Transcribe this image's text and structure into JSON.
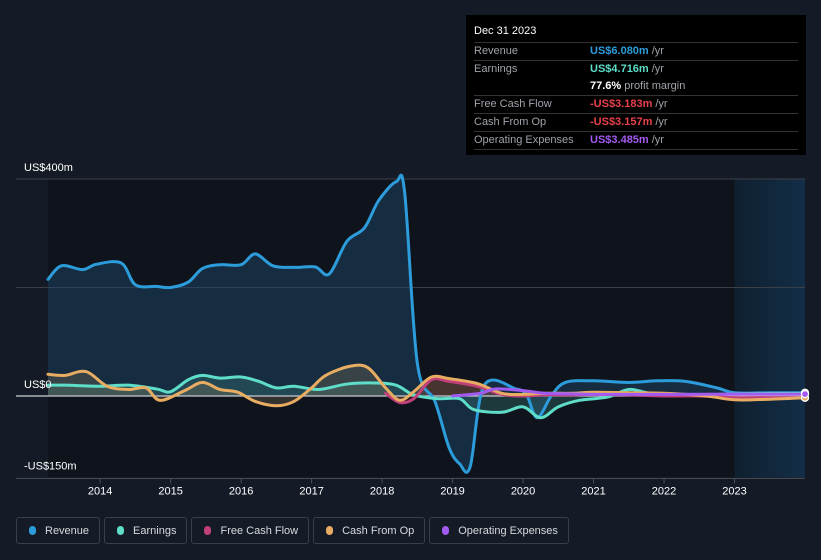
{
  "tooltip": {
    "date": "Dec 31 2023",
    "rows": [
      {
        "label": "Revenue",
        "value": "US$6.080m",
        "unit": "/yr",
        "color": "#2d9cdb"
      },
      {
        "label": "Earnings",
        "value": "US$4.716m",
        "unit": "/yr",
        "color": "#5eddc8"
      },
      {
        "label": "",
        "value": "77.6%",
        "unit": "profit margin",
        "color": "#ffffff"
      },
      {
        "label": "Free Cash Flow",
        "value": "-US$3.183m",
        "unit": "/yr",
        "color": "#e8414b"
      },
      {
        "label": "Cash From Op",
        "value": "-US$3.157m",
        "unit": "/yr",
        "color": "#e8414b"
      },
      {
        "label": "Operating Expenses",
        "value": "US$3.485m",
        "unit": "/yr",
        "color": "#a35af0"
      }
    ]
  },
  "legend": [
    {
      "label": "Revenue",
      "color": "#2d9cdb"
    },
    {
      "label": "Earnings",
      "color": "#5eddc8"
    },
    {
      "label": "Free Cash Flow",
      "color": "#c2407a"
    },
    {
      "label": "Cash From Op",
      "color": "#e8ad62"
    },
    {
      "label": "Operating Expenses",
      "color": "#a35af0"
    }
  ],
  "chart_data": {
    "type": "line",
    "title": "",
    "xlabel": "",
    "ylabel": "",
    "ylim": [
      -150,
      400
    ],
    "xlim": [
      2013.26,
      2024.0
    ],
    "y_tick_labels": [
      {
        "value": 400,
        "label": "US$400m"
      },
      {
        "value": 0,
        "label": "US$0"
      },
      {
        "value": -150,
        "label": "-US$150m"
      }
    ],
    "gridlines": [
      400,
      200,
      0
    ],
    "x_ticks": [
      2014,
      2015,
      2016,
      2017,
      2018,
      2019,
      2020,
      2021,
      2022,
      2023
    ],
    "forecast_shade_start": 2023.0,
    "series": [
      {
        "name": "Revenue",
        "color": "#2d9cdb",
        "fill": true,
        "points": [
          [
            2013.26,
            215
          ],
          [
            2013.45,
            240
          ],
          [
            2013.75,
            233
          ],
          [
            2013.95,
            243
          ],
          [
            2014.3,
            245
          ],
          [
            2014.5,
            205
          ],
          [
            2014.8,
            202
          ],
          [
            2015.0,
            200
          ],
          [
            2015.25,
            210
          ],
          [
            2015.45,
            235
          ],
          [
            2015.7,
            242
          ],
          [
            2016.0,
            242
          ],
          [
            2016.2,
            262
          ],
          [
            2016.45,
            240
          ],
          [
            2016.75,
            237
          ],
          [
            2017.05,
            238
          ],
          [
            2017.25,
            225
          ],
          [
            2017.5,
            285
          ],
          [
            2017.75,
            310
          ],
          [
            2017.95,
            360
          ],
          [
            2018.2,
            395
          ],
          [
            2018.32,
            375
          ],
          [
            2018.5,
            60
          ],
          [
            2018.75,
            -10
          ],
          [
            2018.95,
            -95
          ],
          [
            2019.1,
            -125
          ],
          [
            2019.25,
            -130
          ],
          [
            2019.45,
            20
          ],
          [
            2019.9,
            13
          ],
          [
            2020.05,
            2
          ],
          [
            2020.2,
            -40
          ],
          [
            2020.4,
            0
          ],
          [
            2020.6,
            25
          ],
          [
            2021.0,
            28
          ],
          [
            2021.5,
            25
          ],
          [
            2021.9,
            28
          ],
          [
            2022.3,
            27
          ],
          [
            2022.75,
            15
          ],
          [
            2023.0,
            6
          ],
          [
            2023.5,
            6
          ],
          [
            2024.0,
            6.08
          ]
        ]
      },
      {
        "name": "Earnings",
        "color": "#5eddc8",
        "fill": true,
        "points": [
          [
            2013.26,
            20
          ],
          [
            2013.5,
            20
          ],
          [
            2014.0,
            18
          ],
          [
            2014.4,
            20
          ],
          [
            2014.8,
            13
          ],
          [
            2015.0,
            8
          ],
          [
            2015.25,
            30
          ],
          [
            2015.45,
            38
          ],
          [
            2015.7,
            33
          ],
          [
            2016.0,
            35
          ],
          [
            2016.25,
            27
          ],
          [
            2016.5,
            15
          ],
          [
            2016.75,
            18
          ],
          [
            2017.1,
            12
          ],
          [
            2017.5,
            22
          ],
          [
            2017.9,
            24
          ],
          [
            2018.2,
            20
          ],
          [
            2018.45,
            2
          ],
          [
            2018.8,
            -5
          ],
          [
            2019.1,
            -5
          ],
          [
            2019.3,
            -25
          ],
          [
            2019.7,
            -30
          ],
          [
            2020.0,
            -20
          ],
          [
            2020.25,
            -40
          ],
          [
            2020.5,
            -20
          ],
          [
            2020.8,
            -8
          ],
          [
            2021.2,
            -2
          ],
          [
            2021.5,
            12
          ],
          [
            2021.8,
            5
          ],
          [
            2022.2,
            2
          ],
          [
            2022.6,
            2
          ],
          [
            2023.0,
            4
          ],
          [
            2023.5,
            4.5
          ],
          [
            2024.0,
            4.716
          ]
        ]
      },
      {
        "name": "Free Cash Flow",
        "color": "#c2407a",
        "fill": true,
        "points": [
          [
            2018.05,
            5
          ],
          [
            2018.25,
            -12
          ],
          [
            2018.45,
            -5
          ],
          [
            2018.7,
            30
          ],
          [
            2018.95,
            27
          ],
          [
            2019.35,
            18
          ],
          [
            2019.7,
            3
          ],
          [
            2020.0,
            0
          ],
          [
            2020.3,
            2
          ],
          [
            2020.7,
            2
          ],
          [
            2021.0,
            3
          ],
          [
            2021.5,
            2
          ],
          [
            2022.0,
            0
          ],
          [
            2022.5,
            0
          ],
          [
            2023.0,
            -3
          ],
          [
            2023.5,
            -3
          ],
          [
            2024.0,
            -3.183
          ]
        ]
      },
      {
        "name": "Cash From Op",
        "color": "#e8ad62",
        "fill": true,
        "points": [
          [
            2013.26,
            40
          ],
          [
            2013.5,
            38
          ],
          [
            2013.8,
            45
          ],
          [
            2014.1,
            18
          ],
          [
            2014.4,
            12
          ],
          [
            2014.65,
            15
          ],
          [
            2014.85,
            -8
          ],
          [
            2015.2,
            10
          ],
          [
            2015.45,
            25
          ],
          [
            2015.7,
            12
          ],
          [
            2015.95,
            7
          ],
          [
            2016.2,
            -10
          ],
          [
            2016.5,
            -18
          ],
          [
            2016.75,
            -10
          ],
          [
            2017.0,
            15
          ],
          [
            2017.2,
            38
          ],
          [
            2017.55,
            55
          ],
          [
            2017.8,
            52
          ],
          [
            2018.05,
            15
          ],
          [
            2018.25,
            -8
          ],
          [
            2018.45,
            8
          ],
          [
            2018.7,
            35
          ],
          [
            2018.95,
            32
          ],
          [
            2019.35,
            23
          ],
          [
            2019.7,
            5
          ],
          [
            2020.0,
            3
          ],
          [
            2020.3,
            5
          ],
          [
            2020.7,
            5
          ],
          [
            2021.0,
            7
          ],
          [
            2021.5,
            6
          ],
          [
            2022.0,
            5
          ],
          [
            2022.6,
            0
          ],
          [
            2023.0,
            -7
          ],
          [
            2023.5,
            -6
          ],
          [
            2024.0,
            -3.157
          ]
        ]
      },
      {
        "name": "Operating Expenses",
        "color": "#a35af0",
        "fill": false,
        "points": [
          [
            2019.0,
            0
          ],
          [
            2019.4,
            5
          ],
          [
            2019.6,
            13
          ],
          [
            2020.0,
            10
          ],
          [
            2020.3,
            5
          ],
          [
            2020.7,
            4
          ],
          [
            2021.0,
            3
          ],
          [
            2022.0,
            3
          ],
          [
            2023.0,
            3.5
          ],
          [
            2024.0,
            3.485
          ]
        ]
      }
    ]
  }
}
